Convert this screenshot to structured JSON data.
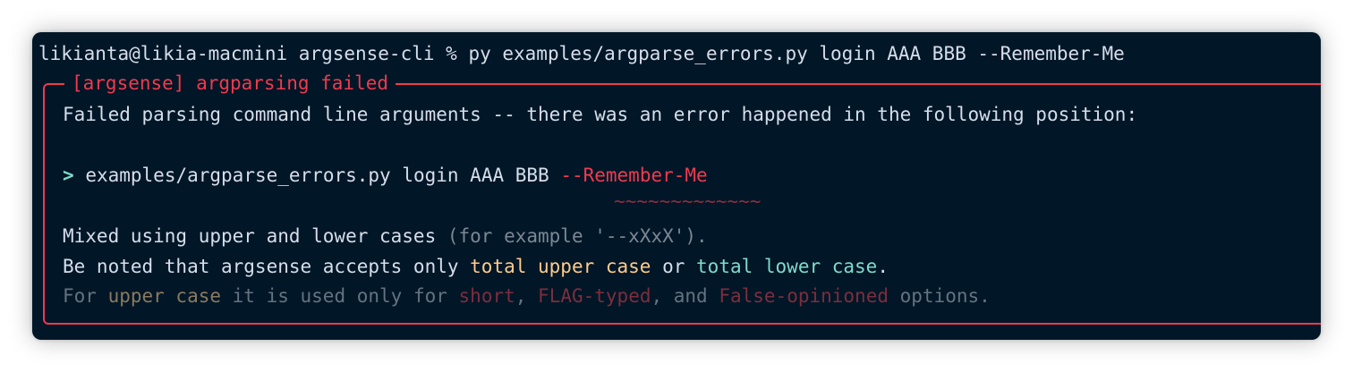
{
  "terminal": {
    "prompt": "likianta@likia-macmini argsense-cli % ",
    "command": "py examples/argparse_errors.py login AAA BBB --Remember-Me"
  },
  "panel": {
    "title": "[argsense] argparsing failed",
    "message": "Failed parsing command line arguments -- there was an error happened in the following position:",
    "caret": ">",
    "cmd_prefix": "examples/argparse_errors.py login AAA BBB ",
    "cmd_error": "--Remember-Me",
    "squiggle": "~~~~~~~~~~~~~",
    "line1_main": "Mixed using upper and lower cases ",
    "line1_hint": "(for example '--xXxX').",
    "line2_a": "Be noted that argsense accepts only ",
    "line2_upper": "total upper case",
    "line2_or": " or ",
    "line2_lower": "total lower case",
    "line2_end": ".",
    "line3_a": "For ",
    "line3_upper": "upper case",
    "line3_b": " it is used only for ",
    "line3_short": "short",
    "line3_c": ", ",
    "line3_flag": "FLAG-typed",
    "line3_d": ", and ",
    "line3_false": "False-opinioned",
    "line3_e": " options."
  },
  "colors": {
    "background": "#011627",
    "border_red": "#ef3a4e",
    "yellow": "#ffcb8b",
    "cyan": "#7fdbca"
  }
}
